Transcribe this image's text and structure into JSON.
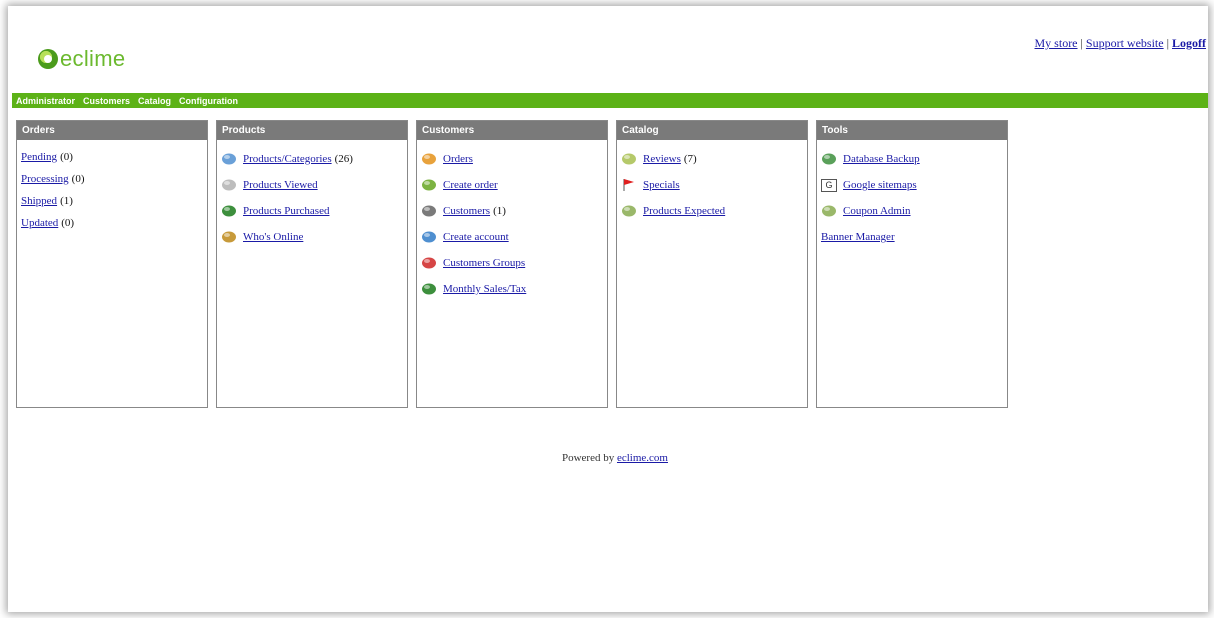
{
  "brand": {
    "logo_text": "eclime"
  },
  "top_links": {
    "my_store": "My store",
    "sep1": " | ",
    "support": "Support website",
    "sep2": " | ",
    "logoff": "Logoff"
  },
  "nav": [
    "Administrator",
    "Customers",
    "Catalog",
    "Configuration"
  ],
  "panels": {
    "orders": {
      "title": "Orders",
      "items": [
        {
          "label": "Pending",
          "count": "(0)"
        },
        {
          "label": "Processing",
          "count": "(0)"
        },
        {
          "label": "Shipped",
          "count": "(1)"
        },
        {
          "label": "Updated",
          "count": "(0)"
        }
      ]
    },
    "products": {
      "title": "Products",
      "items": [
        {
          "label": "Products/Categories",
          "count": "(26)",
          "icon": "tag-icon",
          "color": "#6aa0d8"
        },
        {
          "label": "Products Viewed",
          "count": "",
          "icon": "eye-icon",
          "color": "#bdbdbd"
        },
        {
          "label": "Products Purchased",
          "count": "",
          "icon": "cart-icon",
          "color": "#3d8f3d"
        },
        {
          "label": "Who's Online",
          "count": "",
          "icon": "user-icon",
          "color": "#c79a3a"
        }
      ]
    },
    "customers": {
      "title": "Customers",
      "items": [
        {
          "label": "Orders",
          "count": "",
          "icon": "order-icon",
          "color": "#e8a23c"
        },
        {
          "label": "Create order",
          "count": "",
          "icon": "create-order-icon",
          "color": "#7cb342"
        },
        {
          "label": "Customers",
          "count": "(1)",
          "icon": "customers-icon",
          "color": "#7a7a7a"
        },
        {
          "label": "Create account",
          "count": "",
          "icon": "create-account-icon",
          "color": "#4f8fd0"
        },
        {
          "label": "Customers Groups",
          "count": "",
          "icon": "groups-icon",
          "color": "#d64545"
        },
        {
          "label": "Monthly Sales/Tax",
          "count": "",
          "icon": "sales-icon",
          "color": "#3d8f3d"
        }
      ]
    },
    "catalog": {
      "title": "Catalog",
      "items": [
        {
          "label": "Reviews",
          "count": "(7)",
          "icon": "reviews-icon",
          "color": "#b5c96a"
        },
        {
          "label": "Specials",
          "count": "",
          "icon": "flag-icon",
          "color": "#e02020"
        },
        {
          "label": "Products Expected",
          "count": "",
          "icon": "expected-icon",
          "color": "#9ab86a"
        }
      ]
    },
    "tools": {
      "title": "Tools",
      "items": [
        {
          "label": "Database Backup",
          "icon": "database-icon",
          "color": "#5aa05a"
        },
        {
          "label": "Google sitemaps",
          "icon": "google-icon",
          "color": "#555555"
        },
        {
          "label": "Coupon Admin",
          "icon": "coupon-icon",
          "color": "#9ab86a"
        },
        {
          "label": "Banner Manager",
          "icon": "",
          "color": ""
        }
      ]
    }
  },
  "footer": {
    "prefix": "Powered by ",
    "link": "eclime.com"
  }
}
